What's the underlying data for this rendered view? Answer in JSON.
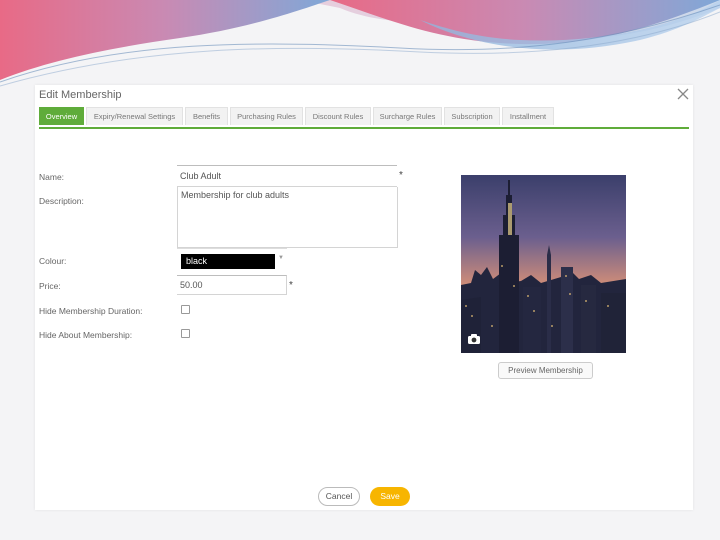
{
  "modal": {
    "title": "Edit Membership"
  },
  "tabs": [
    {
      "label": "Overview",
      "active": true
    },
    {
      "label": "Expiry/Renewal Settings",
      "active": false
    },
    {
      "label": "Benefits",
      "active": false
    },
    {
      "label": "Purchasing Rules",
      "active": false
    },
    {
      "label": "Discount Rules",
      "active": false
    },
    {
      "label": "Surcharge Rules",
      "active": false
    },
    {
      "label": "Subscription",
      "active": false
    },
    {
      "label": "Installment",
      "active": false
    }
  ],
  "form": {
    "name_label": "Name:",
    "name_value": "Club Adult",
    "description_label": "Description:",
    "description_value": "Membership for club adults",
    "colour_label": "Colour:",
    "colour_value": "black",
    "price_label": "Price:",
    "price_value": "50.00",
    "hide_duration_label": "Hide Membership Duration:",
    "hide_duration_checked": false,
    "hide_about_label": "Hide About Membership:",
    "hide_about_checked": false,
    "required_mark": "*"
  },
  "image": {
    "preview_button_label": "Preview Membership",
    "camera_icon": "camera-icon"
  },
  "footer": {
    "cancel_label": "Cancel",
    "save_label": "Save"
  },
  "colors": {
    "accent_green": "#5fac3a",
    "save_yellow": "#f7b500"
  }
}
